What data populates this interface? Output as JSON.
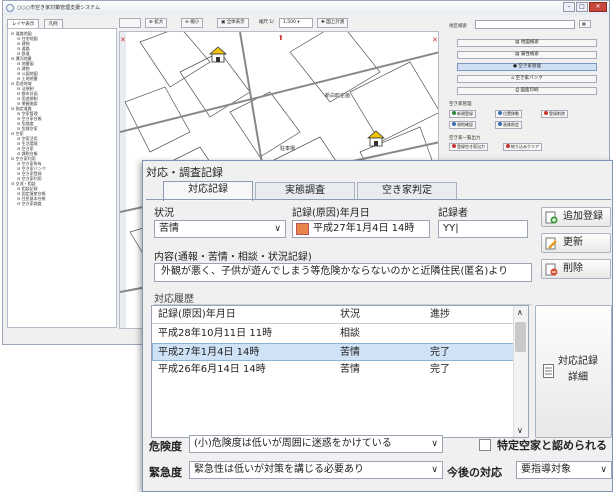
{
  "app": {
    "title": "○○○市空き家対策管理支援システム",
    "left_tabs": [
      "レイヤ表示",
      "凡例"
    ],
    "tree_items": [
      "道路地図",
      "住宅地図",
      "建物",
      "道路",
      "鉄道",
      "運河地番",
      "地番図",
      "建物",
      "公図地図",
      "土地地番",
      "用途地域",
      "法規制",
      "都市計画",
      "用途規制",
      "景観施設",
      "指定道路",
      "空家管理",
      "空き家台帳",
      "危険度",
      "危険空家",
      "空家",
      "空家活用",
      "生活環境",
      "空き家",
      "課税台帳",
      "空き家利用",
      "空き家所有",
      "空き家バンク",
      "空き家登録",
      "空き家利用",
      "交流・相談",
      "相談記録",
      "固定資産台帳",
      "住民基本台帳",
      "空き家調査"
    ],
    "toolbar": {
      "zoom_in": "拡大",
      "zoom_out": "縮小",
      "full_view": "全体表示",
      "scale_label": "縮尺 1/",
      "scale_value": "1,500",
      "print": "図上計測"
    },
    "map_labels": {
      "town": "新白町企画",
      "road": "駐車場"
    },
    "right_panel": {
      "search_label": "地区検索",
      "buttons": [
        "地図検索",
        "属性検索",
        "空き家管理",
        "空き家バンク",
        "図面印刷"
      ],
      "section1": "空き家管理",
      "small_buttons": [
        "新規登録",
        "位置移動",
        "登録削除",
        "現地確認",
        "画像照会"
      ],
      "section2": "空き家一覧出力",
      "small_buttons2": [
        "登録空き家出力",
        "絞り込みクリア"
      ]
    }
  },
  "dialog": {
    "title": "対応・調査記録",
    "tabs": [
      "対応記録",
      "実態調査",
      "空き家判定"
    ],
    "fields": {
      "status_label": "状況",
      "status_value": "苦情",
      "date_label": "記録(原因)年月日",
      "date_value": "平成27年1月4日 14時",
      "recorder_label": "記録者",
      "recorder_value": "YY|",
      "content_label": "内容(通報・苦情・相談・状況記録)",
      "content_value": "外観が悪く、子供が遊んでしまう等危険かならないのかと近隣住民(匿名)より"
    },
    "buttons": {
      "add": "追加登録",
      "update": "更新",
      "delete": "削除",
      "detail": "対応記録\n詳細"
    },
    "history_label": "対応履歴",
    "history": {
      "columns": [
        "記録(原因)年月日",
        "状況",
        "進捗"
      ],
      "rows": [
        [
          "平成28年10月11日 11時",
          "相談",
          ""
        ],
        [
          "平成27年1月4日 14時",
          "苦情",
          "完了"
        ],
        [
          "平成26年6月14日 14時",
          "苦情",
          "完了"
        ]
      ]
    },
    "danger_label": "危険度",
    "danger_value": "(小)危険度は低いが周囲に迷惑をかけている",
    "specified_label": "特定空家と認められる",
    "urgency_label": "緊急度",
    "urgency_value": "緊急性は低いが対策を講じる必要あり",
    "future_label": "今後の対応",
    "future_value": "要指導対象"
  }
}
